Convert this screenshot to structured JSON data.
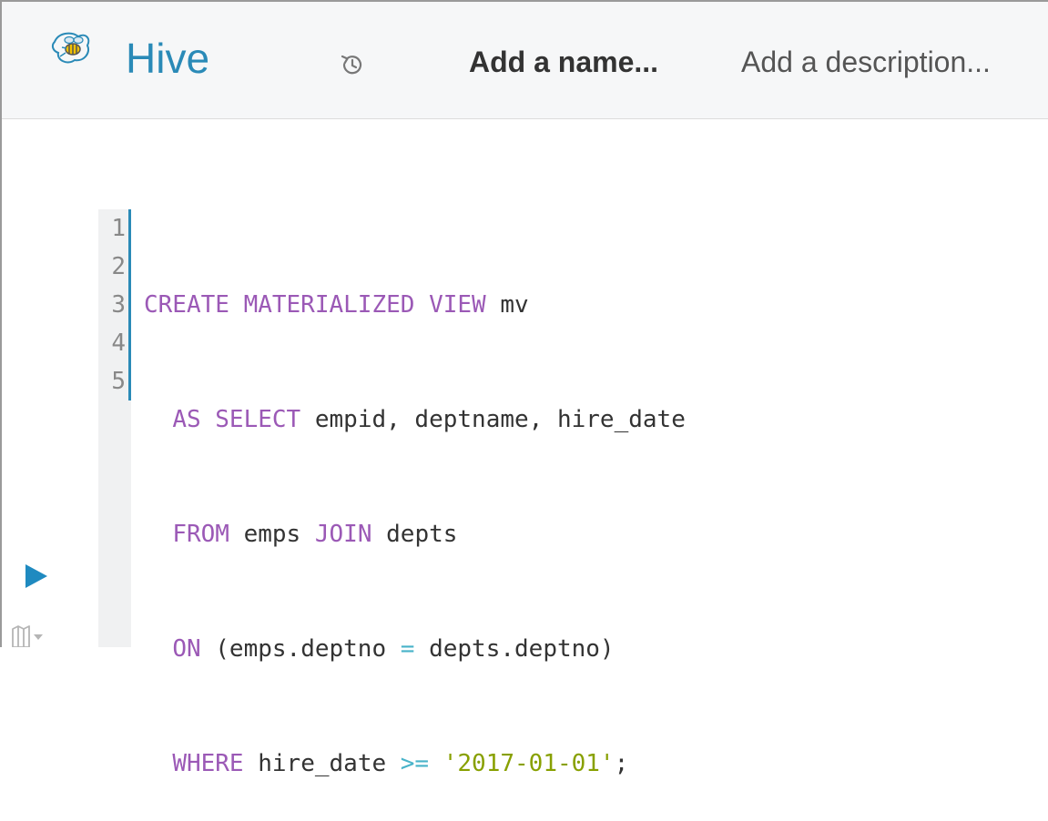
{
  "header": {
    "app_name": "Hive",
    "name_placeholder": "Add a name...",
    "description_placeholder": "Add a description..."
  },
  "colors": {
    "brand": "#2a8ab7",
    "keyword": "#9b59b6",
    "operator": "#48b3c9",
    "string": "#88a000",
    "text": "#333333"
  },
  "icons": {
    "logo": "hive-bee-logo-icon",
    "history": "history-icon",
    "run": "play-icon",
    "assist": "map-icon"
  },
  "editor": {
    "line_numbers": [
      "1",
      "2",
      "3",
      "4",
      "5"
    ],
    "lines": [
      {
        "indent": "",
        "tokens": [
          {
            "type": "keyword",
            "text": "CREATE MATERIALIZED VIEW"
          },
          {
            "type": "plain",
            "text": " mv"
          }
        ]
      },
      {
        "indent": "  ",
        "tokens": [
          {
            "type": "keyword",
            "text": "AS SELECT"
          },
          {
            "type": "plain",
            "text": " empid, deptname, hire_date"
          }
        ]
      },
      {
        "indent": "  ",
        "tokens": [
          {
            "type": "keyword",
            "text": "FROM"
          },
          {
            "type": "plain",
            "text": " emps "
          },
          {
            "type": "keyword",
            "text": "JOIN"
          },
          {
            "type": "plain",
            "text": " depts"
          }
        ]
      },
      {
        "indent": "  ",
        "tokens": [
          {
            "type": "keyword",
            "text": "ON"
          },
          {
            "type": "plain",
            "text": " (emps.deptno "
          },
          {
            "type": "operator",
            "text": "="
          },
          {
            "type": "plain",
            "text": " depts.deptno)"
          }
        ]
      },
      {
        "indent": "  ",
        "tokens": [
          {
            "type": "keyword",
            "text": "WHERE"
          },
          {
            "type": "plain",
            "text": " hire_date "
          },
          {
            "type": "operator",
            "text": ">="
          },
          {
            "type": "plain",
            "text": " "
          },
          {
            "type": "string",
            "text": "'2017-01-01'"
          },
          {
            "type": "plain",
            "text": ";"
          }
        ]
      }
    ]
  }
}
